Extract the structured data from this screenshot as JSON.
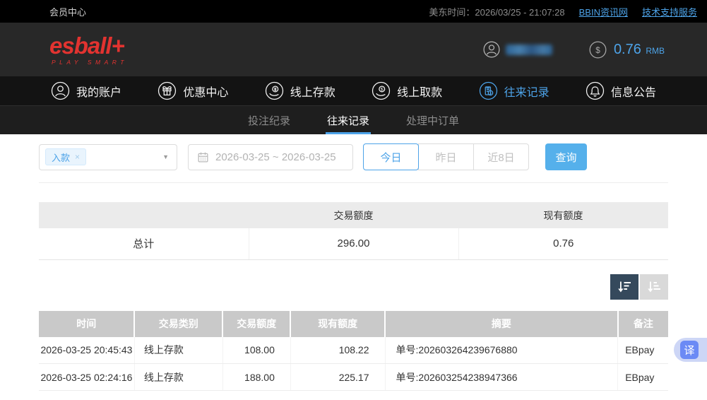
{
  "topbar": {
    "member_center": "会员中心",
    "time": "美东时间：2026/03/25 - 21:07:28",
    "link_bbin": "BBIN资讯网",
    "link_support": "技术支持服务"
  },
  "header": {
    "logo": "esball+",
    "tagline": "PLAY SMART",
    "balance": "0.76",
    "currency": "RMB"
  },
  "nav": {
    "items": [
      {
        "label": "我的账户",
        "icon": "user-icon"
      },
      {
        "label": "优惠中心",
        "icon": "gift-icon"
      },
      {
        "label": "线上存款",
        "icon": "deposit-icon"
      },
      {
        "label": "线上取款",
        "icon": "withdraw-icon"
      },
      {
        "label": "往来记录",
        "icon": "records-icon",
        "active": true
      },
      {
        "label": "信息公告",
        "icon": "bell-icon"
      }
    ]
  },
  "subnav": {
    "tabs": [
      {
        "label": "投注纪录"
      },
      {
        "label": "往来记录",
        "active": true
      },
      {
        "label": "处理中订单"
      }
    ]
  },
  "filters": {
    "type_tag": "入款",
    "tag_remove": "×",
    "caret": "▼",
    "date_range": "2026-03-25 ~ 2026-03-25",
    "quick": [
      "今日",
      "昨日",
      "近8日"
    ],
    "active_quick": "今日",
    "search": "查询"
  },
  "summary": {
    "headers": [
      "",
      "交易额度",
      "现有额度"
    ],
    "total_label": "总计",
    "transaction_amount": "296.00",
    "current_amount": "0.76"
  },
  "records": {
    "headers": [
      "时间",
      "交易类别",
      "交易额度",
      "现有额度",
      "摘要",
      "备注"
    ],
    "rows": [
      {
        "time": "2026-03-25 20:45:43",
        "type": "线上存款",
        "amount": "108.00",
        "balance": "108.22",
        "summary": "单号:202603264239676880",
        "note": "EBpay"
      },
      {
        "time": "2026-03-25 02:24:16",
        "type": "线上存款",
        "amount": "188.00",
        "balance": "225.17",
        "summary": "单号:202603254238947366",
        "note": "EBpay"
      }
    ]
  },
  "translate": {
    "label": "译"
  },
  "colors": {
    "accent": "#4da3e8",
    "search_button": "#55b0eb",
    "logo_red": "#e23330",
    "table_header": "#c9c9c9"
  }
}
